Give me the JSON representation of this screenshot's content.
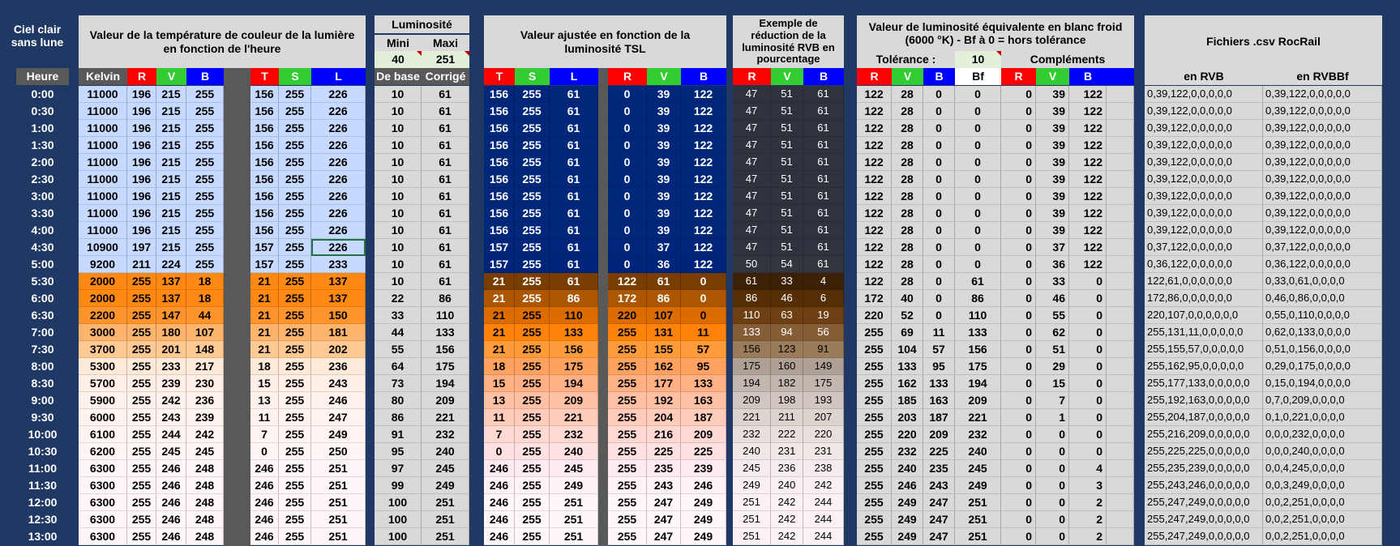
{
  "headers": {
    "side_title": "Ciel clair sans lune",
    "heure": "Heure",
    "temp_title": "Valeur de la température de couleur de la lumière en fonction de l'heure",
    "kelvin": "Kelvin",
    "lum_title": "Luminosité",
    "mini": "Mini",
    "maxi": "Maxi",
    "mini_val": "40",
    "maxi_val": "251",
    "de_base": "De base",
    "corrige": "Corrigé",
    "adj_title": "Valeur ajustée en fonction de la luminosité TSL",
    "reduc_title": "Exemple de réduction de la luminosité RVB en pourcentage",
    "equiv_title": "Valeur de luminosité équivalente en blanc froid (6000 °K) - Bf à 0 = hors tolérance",
    "tolerance": "Tolérance :",
    "tolerance_val": "10",
    "complements": "Compléments",
    "bf": "Bf",
    "csv_title": "Fichiers .csv RocRail",
    "en_rvb": "en RVB",
    "en_rvbbf": "en RVBBf",
    "R": "R",
    "V": "V",
    "B": "B",
    "T": "T",
    "S": "S",
    "L": "L"
  },
  "colors": {
    "background": "#1f3864",
    "red": "#ff0000",
    "green": "#33cc33",
    "blue": "#0000ff"
  },
  "rows": [
    {
      "h": "0:00",
      "k": "11000",
      "rgb": [
        "196",
        "215",
        "255"
      ],
      "tsl": [
        "156",
        "255",
        "226"
      ],
      "lb": "10",
      "lc": "61",
      "adj": [
        "156",
        "255",
        "61"
      ],
      "argb": [
        "0",
        "39",
        "122"
      ],
      "red": [
        "47",
        "51",
        "61"
      ],
      "eq": [
        "122",
        "28",
        "0",
        "0"
      ],
      "comp": [
        "0",
        "39",
        "122"
      ],
      "csv1": "0,39,122,0,0,0,0,0",
      "csv2": "0,39,122,0,0,0,0,0"
    },
    {
      "h": "0:30",
      "k": "11000",
      "rgb": [
        "196",
        "215",
        "255"
      ],
      "tsl": [
        "156",
        "255",
        "226"
      ],
      "lb": "10",
      "lc": "61",
      "adj": [
        "156",
        "255",
        "61"
      ],
      "argb": [
        "0",
        "39",
        "122"
      ],
      "red": [
        "47",
        "51",
        "61"
      ],
      "eq": [
        "122",
        "28",
        "0",
        "0"
      ],
      "comp": [
        "0",
        "39",
        "122"
      ],
      "csv1": "0,39,122,0,0,0,0,0",
      "csv2": "0,39,122,0,0,0,0,0"
    },
    {
      "h": "1:00",
      "k": "11000",
      "rgb": [
        "196",
        "215",
        "255"
      ],
      "tsl": [
        "156",
        "255",
        "226"
      ],
      "lb": "10",
      "lc": "61",
      "adj": [
        "156",
        "255",
        "61"
      ],
      "argb": [
        "0",
        "39",
        "122"
      ],
      "red": [
        "47",
        "51",
        "61"
      ],
      "eq": [
        "122",
        "28",
        "0",
        "0"
      ],
      "comp": [
        "0",
        "39",
        "122"
      ],
      "csv1": "0,39,122,0,0,0,0,0",
      "csv2": "0,39,122,0,0,0,0,0"
    },
    {
      "h": "1:30",
      "k": "11000",
      "rgb": [
        "196",
        "215",
        "255"
      ],
      "tsl": [
        "156",
        "255",
        "226"
      ],
      "lb": "10",
      "lc": "61",
      "adj": [
        "156",
        "255",
        "61"
      ],
      "argb": [
        "0",
        "39",
        "122"
      ],
      "red": [
        "47",
        "51",
        "61"
      ],
      "eq": [
        "122",
        "28",
        "0",
        "0"
      ],
      "comp": [
        "0",
        "39",
        "122"
      ],
      "csv1": "0,39,122,0,0,0,0,0",
      "csv2": "0,39,122,0,0,0,0,0"
    },
    {
      "h": "2:00",
      "k": "11000",
      "rgb": [
        "196",
        "215",
        "255"
      ],
      "tsl": [
        "156",
        "255",
        "226"
      ],
      "lb": "10",
      "lc": "61",
      "adj": [
        "156",
        "255",
        "61"
      ],
      "argb": [
        "0",
        "39",
        "122"
      ],
      "red": [
        "47",
        "51",
        "61"
      ],
      "eq": [
        "122",
        "28",
        "0",
        "0"
      ],
      "comp": [
        "0",
        "39",
        "122"
      ],
      "csv1": "0,39,122,0,0,0,0,0",
      "csv2": "0,39,122,0,0,0,0,0"
    },
    {
      "h": "2:30",
      "k": "11000",
      "rgb": [
        "196",
        "215",
        "255"
      ],
      "tsl": [
        "156",
        "255",
        "226"
      ],
      "lb": "10",
      "lc": "61",
      "adj": [
        "156",
        "255",
        "61"
      ],
      "argb": [
        "0",
        "39",
        "122"
      ],
      "red": [
        "47",
        "51",
        "61"
      ],
      "eq": [
        "122",
        "28",
        "0",
        "0"
      ],
      "comp": [
        "0",
        "39",
        "122"
      ],
      "csv1": "0,39,122,0,0,0,0,0",
      "csv2": "0,39,122,0,0,0,0,0"
    },
    {
      "h": "3:00",
      "k": "11000",
      "rgb": [
        "196",
        "215",
        "255"
      ],
      "tsl": [
        "156",
        "255",
        "226"
      ],
      "lb": "10",
      "lc": "61",
      "adj": [
        "156",
        "255",
        "61"
      ],
      "argb": [
        "0",
        "39",
        "122"
      ],
      "red": [
        "47",
        "51",
        "61"
      ],
      "eq": [
        "122",
        "28",
        "0",
        "0"
      ],
      "comp": [
        "0",
        "39",
        "122"
      ],
      "csv1": "0,39,122,0,0,0,0,0",
      "csv2": "0,39,122,0,0,0,0,0"
    },
    {
      "h": "3:30",
      "k": "11000",
      "rgb": [
        "196",
        "215",
        "255"
      ],
      "tsl": [
        "156",
        "255",
        "226"
      ],
      "lb": "10",
      "lc": "61",
      "adj": [
        "156",
        "255",
        "61"
      ],
      "argb": [
        "0",
        "39",
        "122"
      ],
      "red": [
        "47",
        "51",
        "61"
      ],
      "eq": [
        "122",
        "28",
        "0",
        "0"
      ],
      "comp": [
        "0",
        "39",
        "122"
      ],
      "csv1": "0,39,122,0,0,0,0,0",
      "csv2": "0,39,122,0,0,0,0,0"
    },
    {
      "h": "4:00",
      "k": "11000",
      "rgb": [
        "196",
        "215",
        "255"
      ],
      "tsl": [
        "156",
        "255",
        "226"
      ],
      "lb": "10",
      "lc": "61",
      "adj": [
        "156",
        "255",
        "61"
      ],
      "argb": [
        "0",
        "39",
        "122"
      ],
      "red": [
        "47",
        "51",
        "61"
      ],
      "eq": [
        "122",
        "28",
        "0",
        "0"
      ],
      "comp": [
        "0",
        "39",
        "122"
      ],
      "csv1": "0,39,122,0,0,0,0,0",
      "csv2": "0,39,122,0,0,0,0,0"
    },
    {
      "h": "4:30",
      "k": "10900",
      "rgb": [
        "197",
        "215",
        "255"
      ],
      "tsl": [
        "157",
        "255",
        "226"
      ],
      "lb": "10",
      "lc": "61",
      "adj": [
        "157",
        "255",
        "61"
      ],
      "argb": [
        "0",
        "37",
        "122"
      ],
      "red": [
        "47",
        "51",
        "61"
      ],
      "eq": [
        "122",
        "28",
        "0",
        "0"
      ],
      "comp": [
        "0",
        "37",
        "122"
      ],
      "csv1": "0,37,122,0,0,0,0,0",
      "csv2": "0,37,122,0,0,0,0,0"
    },
    {
      "h": "5:00",
      "k": "9200",
      "rgb": [
        "211",
        "224",
        "255"
      ],
      "tsl": [
        "157",
        "255",
        "233"
      ],
      "lb": "10",
      "lc": "61",
      "adj": [
        "157",
        "255",
        "61"
      ],
      "argb": [
        "0",
        "36",
        "122"
      ],
      "red": [
        "50",
        "54",
        "61"
      ],
      "eq": [
        "122",
        "28",
        "0",
        "0"
      ],
      "comp": [
        "0",
        "36",
        "122"
      ],
      "csv1": "0,36,122,0,0,0,0,0",
      "csv2": "0,36,122,0,0,0,0,0"
    },
    {
      "h": "5:30",
      "k": "2000",
      "rgb": [
        "255",
        "137",
        "18"
      ],
      "tsl": [
        "21",
        "255",
        "137"
      ],
      "lb": "10",
      "lc": "61",
      "adj": [
        "21",
        "255",
        "61"
      ],
      "argb": [
        "122",
        "61",
        "0"
      ],
      "red": [
        "61",
        "33",
        "4"
      ],
      "eq": [
        "122",
        "28",
        "0",
        "61"
      ],
      "comp": [
        "0",
        "33",
        "0"
      ],
      "csv1": "122,61,0,0,0,0,0,0",
      "csv2": "0,33,0,61,0,0,0,0"
    },
    {
      "h": "6:00",
      "k": "2000",
      "rgb": [
        "255",
        "137",
        "18"
      ],
      "tsl": [
        "21",
        "255",
        "137"
      ],
      "lb": "22",
      "lc": "86",
      "adj": [
        "21",
        "255",
        "86"
      ],
      "argb": [
        "172",
        "86",
        "0"
      ],
      "red": [
        "86",
        "46",
        "6"
      ],
      "eq": [
        "172",
        "40",
        "0",
        "86"
      ],
      "comp": [
        "0",
        "46",
        "0"
      ],
      "csv1": "172,86,0,0,0,0,0,0",
      "csv2": "0,46,0,86,0,0,0,0"
    },
    {
      "h": "6:30",
      "k": "2200",
      "rgb": [
        "255",
        "147",
        "44"
      ],
      "tsl": [
        "21",
        "255",
        "150"
      ],
      "lb": "33",
      "lc": "110",
      "adj": [
        "21",
        "255",
        "110"
      ],
      "argb": [
        "220",
        "107",
        "0"
      ],
      "red": [
        "110",
        "63",
        "19"
      ],
      "eq": [
        "220",
        "52",
        "0",
        "110"
      ],
      "comp": [
        "0",
        "55",
        "0"
      ],
      "csv1": "220,107,0,0,0,0,0,0",
      "csv2": "0,55,0,110,0,0,0,0"
    },
    {
      "h": "7:00",
      "k": "3000",
      "rgb": [
        "255",
        "180",
        "107"
      ],
      "tsl": [
        "21",
        "255",
        "181"
      ],
      "lb": "44",
      "lc": "133",
      "adj": [
        "21",
        "255",
        "133"
      ],
      "argb": [
        "255",
        "131",
        "11"
      ],
      "red": [
        "133",
        "94",
        "56"
      ],
      "eq": [
        "255",
        "69",
        "11",
        "133"
      ],
      "comp": [
        "0",
        "62",
        "0"
      ],
      "csv1": "255,131,11,0,0,0,0,0",
      "csv2": "0,62,0,133,0,0,0,0"
    },
    {
      "h": "7:30",
      "k": "3700",
      "rgb": [
        "255",
        "201",
        "148"
      ],
      "tsl": [
        "21",
        "255",
        "202"
      ],
      "lb": "55",
      "lc": "156",
      "adj": [
        "21",
        "255",
        "156"
      ],
      "argb": [
        "255",
        "155",
        "57"
      ],
      "red": [
        "156",
        "123",
        "91"
      ],
      "eq": [
        "255",
        "104",
        "57",
        "156"
      ],
      "comp": [
        "0",
        "51",
        "0"
      ],
      "csv1": "255,155,57,0,0,0,0,0",
      "csv2": "0,51,0,156,0,0,0,0"
    },
    {
      "h": "8:00",
      "k": "5300",
      "rgb": [
        "255",
        "233",
        "217"
      ],
      "tsl": [
        "18",
        "255",
        "236"
      ],
      "lb": "64",
      "lc": "175",
      "adj": [
        "18",
        "255",
        "175"
      ],
      "argb": [
        "255",
        "162",
        "95"
      ],
      "red": [
        "175",
        "160",
        "149"
      ],
      "eq": [
        "255",
        "133",
        "95",
        "175"
      ],
      "comp": [
        "0",
        "29",
        "0"
      ],
      "csv1": "255,162,95,0,0,0,0,0",
      "csv2": "0,29,0,175,0,0,0,0"
    },
    {
      "h": "8:30",
      "k": "5700",
      "rgb": [
        "255",
        "239",
        "230"
      ],
      "tsl": [
        "15",
        "255",
        "243"
      ],
      "lb": "73",
      "lc": "194",
      "adj": [
        "15",
        "255",
        "194"
      ],
      "argb": [
        "255",
        "177",
        "133"
      ],
      "red": [
        "194",
        "182",
        "175"
      ],
      "eq": [
        "255",
        "162",
        "133",
        "194"
      ],
      "comp": [
        "0",
        "15",
        "0"
      ],
      "csv1": "255,177,133,0,0,0,0,0",
      "csv2": "0,15,0,194,0,0,0,0"
    },
    {
      "h": "9:00",
      "k": "5900",
      "rgb": [
        "255",
        "242",
        "236"
      ],
      "tsl": [
        "13",
        "255",
        "246"
      ],
      "lb": "80",
      "lc": "209",
      "adj": [
        "13",
        "255",
        "209"
      ],
      "argb": [
        "255",
        "192",
        "163"
      ],
      "red": [
        "209",
        "198",
        "193"
      ],
      "eq": [
        "255",
        "185",
        "163",
        "209"
      ],
      "comp": [
        "0",
        "7",
        "0"
      ],
      "csv1": "255,192,163,0,0,0,0,0",
      "csv2": "0,7,0,209,0,0,0,0"
    },
    {
      "h": "9:30",
      "k": "6000",
      "rgb": [
        "255",
        "243",
        "239"
      ],
      "tsl": [
        "11",
        "255",
        "247"
      ],
      "lb": "86",
      "lc": "221",
      "adj": [
        "11",
        "255",
        "221"
      ],
      "argb": [
        "255",
        "204",
        "187"
      ],
      "red": [
        "221",
        "211",
        "207"
      ],
      "eq": [
        "255",
        "203",
        "187",
        "221"
      ],
      "comp": [
        "0",
        "1",
        "0"
      ],
      "csv1": "255,204,187,0,0,0,0,0",
      "csv2": "0,1,0,221,0,0,0,0"
    },
    {
      "h": "10:00",
      "k": "6100",
      "rgb": [
        "255",
        "244",
        "242"
      ],
      "tsl": [
        "7",
        "255",
        "249"
      ],
      "lb": "91",
      "lc": "232",
      "adj": [
        "7",
        "255",
        "232"
      ],
      "argb": [
        "255",
        "216",
        "209"
      ],
      "red": [
        "232",
        "222",
        "220"
      ],
      "eq": [
        "255",
        "220",
        "209",
        "232"
      ],
      "comp": [
        "0",
        "0",
        "0"
      ],
      "csv1": "255,216,209,0,0,0,0,0",
      "csv2": "0,0,0,232,0,0,0,0"
    },
    {
      "h": "10:30",
      "k": "6200",
      "rgb": [
        "255",
        "245",
        "245"
      ],
      "tsl": [
        "0",
        "255",
        "250"
      ],
      "lb": "95",
      "lc": "240",
      "adj": [
        "0",
        "255",
        "240"
      ],
      "argb": [
        "255",
        "225",
        "225"
      ],
      "red": [
        "240",
        "231",
        "231"
      ],
      "eq": [
        "255",
        "232",
        "225",
        "240"
      ],
      "comp": [
        "0",
        "0",
        "0"
      ],
      "csv1": "255,225,225,0,0,0,0,0",
      "csv2": "0,0,0,240,0,0,0,0"
    },
    {
      "h": "11:00",
      "k": "6300",
      "rgb": [
        "255",
        "246",
        "248"
      ],
      "tsl": [
        "246",
        "255",
        "251"
      ],
      "lb": "97",
      "lc": "245",
      "adj": [
        "246",
        "255",
        "245"
      ],
      "argb": [
        "255",
        "235",
        "239"
      ],
      "red": [
        "245",
        "236",
        "238"
      ],
      "eq": [
        "255",
        "240",
        "235",
        "245"
      ],
      "comp": [
        "0",
        "0",
        "4"
      ],
      "csv1": "255,235,239,0,0,0,0,0",
      "csv2": "0,0,4,245,0,0,0,0"
    },
    {
      "h": "11:30",
      "k": "6300",
      "rgb": [
        "255",
        "246",
        "248"
      ],
      "tsl": [
        "246",
        "255",
        "251"
      ],
      "lb": "99",
      "lc": "249",
      "adj": [
        "246",
        "255",
        "249"
      ],
      "argb": [
        "255",
        "243",
        "246"
      ],
      "red": [
        "249",
        "240",
        "242"
      ],
      "eq": [
        "255",
        "246",
        "243",
        "249"
      ],
      "comp": [
        "0",
        "0",
        "3"
      ],
      "csv1": "255,243,246,0,0,0,0,0",
      "csv2": "0,0,3,249,0,0,0,0"
    },
    {
      "h": "12:00",
      "k": "6300",
      "rgb": [
        "255",
        "246",
        "248"
      ],
      "tsl": [
        "246",
        "255",
        "251"
      ],
      "lb": "100",
      "lc": "251",
      "adj": [
        "246",
        "255",
        "251"
      ],
      "argb": [
        "255",
        "247",
        "249"
      ],
      "red": [
        "251",
        "242",
        "244"
      ],
      "eq": [
        "255",
        "249",
        "247",
        "251"
      ],
      "comp": [
        "0",
        "0",
        "2"
      ],
      "csv1": "255,247,249,0,0,0,0,0",
      "csv2": "0,0,2,251,0,0,0,0"
    },
    {
      "h": "12:30",
      "k": "6300",
      "rgb": [
        "255",
        "246",
        "248"
      ],
      "tsl": [
        "246",
        "255",
        "251"
      ],
      "lb": "100",
      "lc": "251",
      "adj": [
        "246",
        "255",
        "251"
      ],
      "argb": [
        "255",
        "247",
        "249"
      ],
      "red": [
        "251",
        "242",
        "244"
      ],
      "eq": [
        "255",
        "249",
        "247",
        "251"
      ],
      "comp": [
        "0",
        "0",
        "2"
      ],
      "csv1": "255,247,249,0,0,0,0,0",
      "csv2": "0,0,2,251,0,0,0,0"
    },
    {
      "h": "13:00",
      "k": "6300",
      "rgb": [
        "255",
        "246",
        "248"
      ],
      "tsl": [
        "246",
        "255",
        "251"
      ],
      "lb": "100",
      "lc": "251",
      "adj": [
        "246",
        "255",
        "251"
      ],
      "argb": [
        "255",
        "247",
        "249"
      ],
      "red": [
        "251",
        "242",
        "244"
      ],
      "eq": [
        "255",
        "249",
        "247",
        "251"
      ],
      "comp": [
        "0",
        "0",
        "2"
      ],
      "csv1": "255,247,249,0,0,0,0,0",
      "csv2": "0,0,2,251,0,0,0,0"
    }
  ]
}
